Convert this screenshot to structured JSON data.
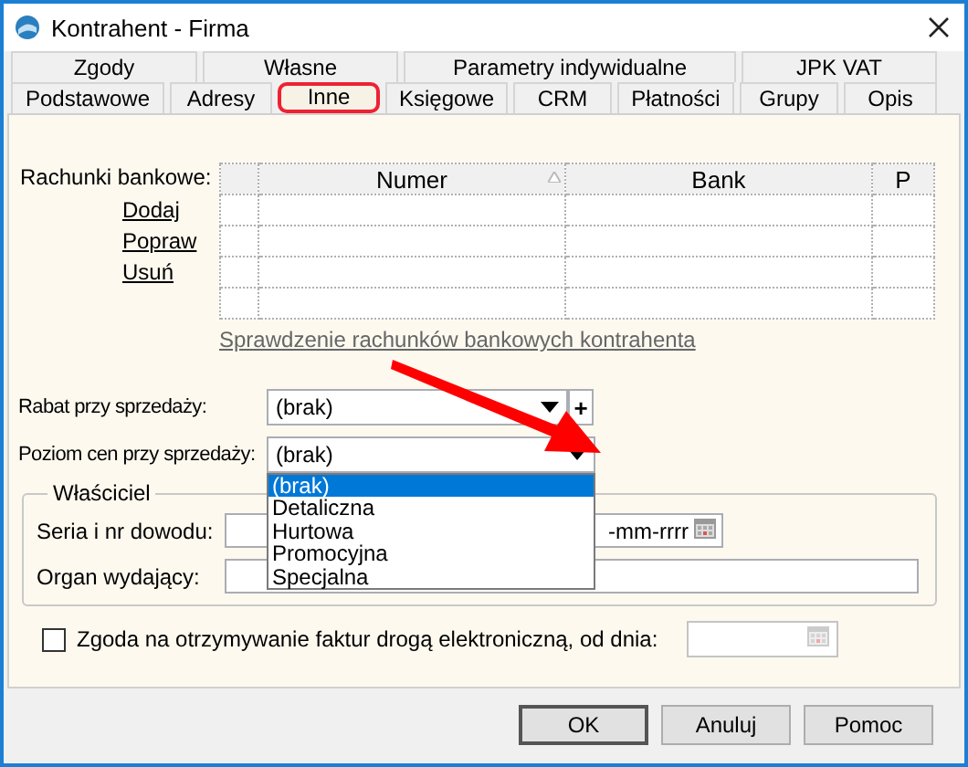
{
  "window": {
    "title": "Kontrahent - Firma"
  },
  "tabs": [
    [
      {
        "label": "Zgody",
        "selected": false
      },
      {
        "label": "Własne",
        "selected": false
      },
      {
        "label": "Parametry indywidualne",
        "selected": false
      },
      {
        "label": "JPK VAT",
        "selected": false
      }
    ],
    [
      {
        "label": "Podstawowe",
        "selected": false
      },
      {
        "label": "Adresy",
        "selected": false
      },
      {
        "label": "Inne",
        "selected": true
      },
      {
        "label": "Księgowe",
        "selected": false
      },
      {
        "label": "CRM",
        "selected": false
      },
      {
        "label": "Płatności",
        "selected": false
      },
      {
        "label": "Grupy",
        "selected": false
      },
      {
        "label": "Opis",
        "selected": false
      }
    ]
  ],
  "bank_accounts": {
    "label": "Rachunki bankowe:",
    "actions": [
      "Dodaj",
      "Popraw",
      "Usuń"
    ],
    "columns": [
      {
        "label": "Numer",
        "sorted": true
      },
      {
        "label": "Bank",
        "sorted": false
      },
      {
        "label": "P",
        "sorted": false
      }
    ],
    "check_link": "Sprawdzenie rachunków bankowych kontrahenta"
  },
  "discount": {
    "label": "Rabat przy sprzedaży:",
    "value": "(brak)",
    "add": "+"
  },
  "price_level": {
    "label": "Poziom cen przy sprzedaży:",
    "value": "(brak)",
    "expanded": true,
    "options": [
      {
        "label": "(brak)",
        "selected": true
      },
      {
        "label": "Detaliczna",
        "selected": false
      },
      {
        "label": "Hurtowa",
        "selected": false
      },
      {
        "label": "Promocyjna",
        "selected": false
      },
      {
        "label": "Specjalna",
        "selected": false
      }
    ]
  },
  "owner": {
    "title": "Właściciel",
    "id_label": "Seria i nr dowodu:",
    "date_placeholder": "-mm-rrrr",
    "issuer_label": "Organ wydający:"
  },
  "e_invoice": {
    "label": "Zgoda na otrzymywanie faktur drogą elektroniczną, od dnia:",
    "checked": false
  },
  "buttons": [
    {
      "label": "OK",
      "default": true
    },
    {
      "label": "Anuluj",
      "default": false
    },
    {
      "label": "Pomoc",
      "default": false
    }
  ]
}
